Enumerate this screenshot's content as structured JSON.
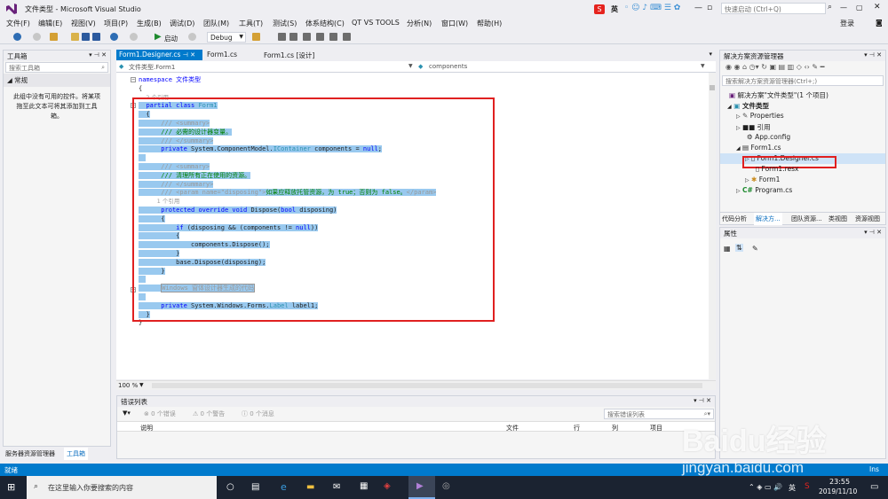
{
  "window": {
    "title": "文件类型 - Microsoft Visual Studio",
    "quick_launch_placeholder": "快速启动 (Ctrl+Q)",
    "login": "登录"
  },
  "ime": {
    "label": "英"
  },
  "menu": [
    "文件(F)",
    "编辑(E)",
    "视图(V)",
    "项目(P)",
    "生成(B)",
    "调试(D)",
    "团队(M)",
    "工具(T)",
    "测试(S)",
    "体系结构(C)",
    "QT VS TOOLS",
    "分析(N)",
    "窗口(W)",
    "帮助(H)"
  ],
  "toolbar": {
    "start_label": "启动",
    "config": "Debug"
  },
  "toolbox": {
    "title": "工具箱",
    "search_placeholder": "搜索工具箱",
    "group": "常规",
    "empty_text": "此组中没有可用的控件。将某项拖至此文本可将其添加到工具箱。",
    "tab_server": "服务器资源管理器",
    "tab_toolbox": "工具箱"
  },
  "doc_tabs": [
    "Form1.Designer.cs",
    "Form1.cs",
    "Form1.cs [设计]"
  ],
  "nav": {
    "left": "文件类型.Form1",
    "right": "components"
  },
  "code": {
    "l1": "namespace 文件类型",
    "l2": "{",
    "l3": "2 个引用",
    "l4a": "partial class ",
    "l4b": "Form1",
    "l5": "{",
    "l6": "/// <summary>",
    "l7": "/// 必需的设计器变量。",
    "l8": "/// </summary>",
    "l9a": "private ",
    "l9b": "System.ComponentModel.",
    "l9c": "IContainer",
    "l9d": " components = ",
    "l9e": "null",
    "l9f": ";",
    "l10": "/// <summary>",
    "l11": "/// 清理所有正在使用的资源。",
    "l12": "/// </summary>",
    "l13a": "/// <param name=\"disposing\">",
    "l13b": "如果应释放托管资源，为 true；否则为 false。",
    "l13c": "</param>",
    "l14": "1 个引用",
    "l15a": "protected override void ",
    "l15b": "Dispose(",
    "l15c": "bool",
    "l15d": " disposing)",
    "l16": "{",
    "l17a": "if",
    "l17b": " (disposing && (components != ",
    "l17c": "null",
    "l17d": "))",
    "l18": "{",
    "l19": "components.Dispose();",
    "l20": "}",
    "l21": "base.Dispose(disposing);",
    "l22": "}",
    "l23": "Windows 窗体设计器生成的代码",
    "l24a": "private ",
    "l24b": "System.Windows.Forms.",
    "l24c": "Label",
    "l24d": " label1;",
    "l25": "}",
    "l26": "}"
  },
  "zoom": "100 %",
  "errors": {
    "title": "错误列表",
    "errors": "0 个错误",
    "warnings": "0 个警告",
    "messages": "0 个消息",
    "search_placeholder": "搜索错误列表",
    "col_desc": "说明",
    "col_file": "文件",
    "col_line": "行",
    "col_col": "列",
    "col_project": "项目"
  },
  "solution": {
    "title": "解决方案资源管理器",
    "search_placeholder": "搜索解决方案资源管理器(Ctrl+;)",
    "items": [
      "解决方案\"文件类型\"(1 个项目)",
      "文件类型",
      "Properties",
      "引用",
      "App.config",
      "Form1.cs",
      "Form1.Designer.cs",
      "Form1.resx",
      "Form1",
      "Program.cs"
    ],
    "tabs": [
      "代码分析",
      "解决方...",
      "团队资源...",
      "类视图",
      "资源视图"
    ]
  },
  "properties": {
    "title": "属性"
  },
  "status": {
    "text": "就绪",
    "mode": "Ins"
  },
  "taskbar": {
    "search": "在这里输入你要搜索的内容",
    "lang": "英",
    "time": "23:55",
    "date": "2019/11/10"
  },
  "watermark": {
    "top": "Baidu经验",
    "bottom": "jingyan.baidu.com"
  },
  "colors": {
    "accent": "#007acc",
    "selection": "#99c9ef",
    "highlight_box": "#e02020",
    "keyword": "#0000ff",
    "comment": "#008000",
    "type": "#2b91af"
  }
}
